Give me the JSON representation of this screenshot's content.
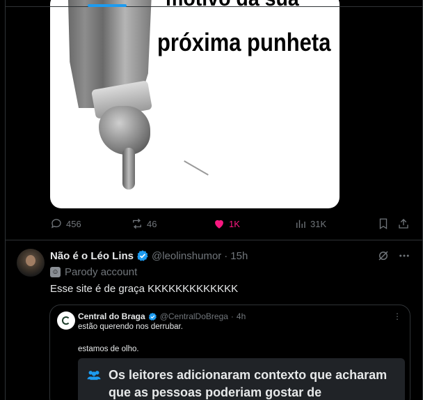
{
  "media": {
    "meme_top": "motivo da sua",
    "meme_bottom": "próxima punheta"
  },
  "actions": {
    "replies": "456",
    "reposts": "46",
    "likes": "1K",
    "views": "31K"
  },
  "colors": {
    "accent": "#1d9bf0",
    "like": "#f91880",
    "muted": "#71767b",
    "verified": "#1d9bf0"
  },
  "tweet": {
    "display_name": "Não é o Léo Lins",
    "handle": "@leolinshumor",
    "separator": "·",
    "time": "15h",
    "parody_label": "Parody account",
    "text": "Esse site é de graça KKKKKKKKKKKKK"
  },
  "quote": {
    "display_name": "Central do Braga",
    "handle": "@CentralDoBrega",
    "separator": "·",
    "time": "4h",
    "line1": "estão querendo nos derrubar.",
    "line2": "estamos de olho.",
    "context_title": "Os leitores adicionaram contexto que acharam que as pessoas poderiam gostar de"
  }
}
